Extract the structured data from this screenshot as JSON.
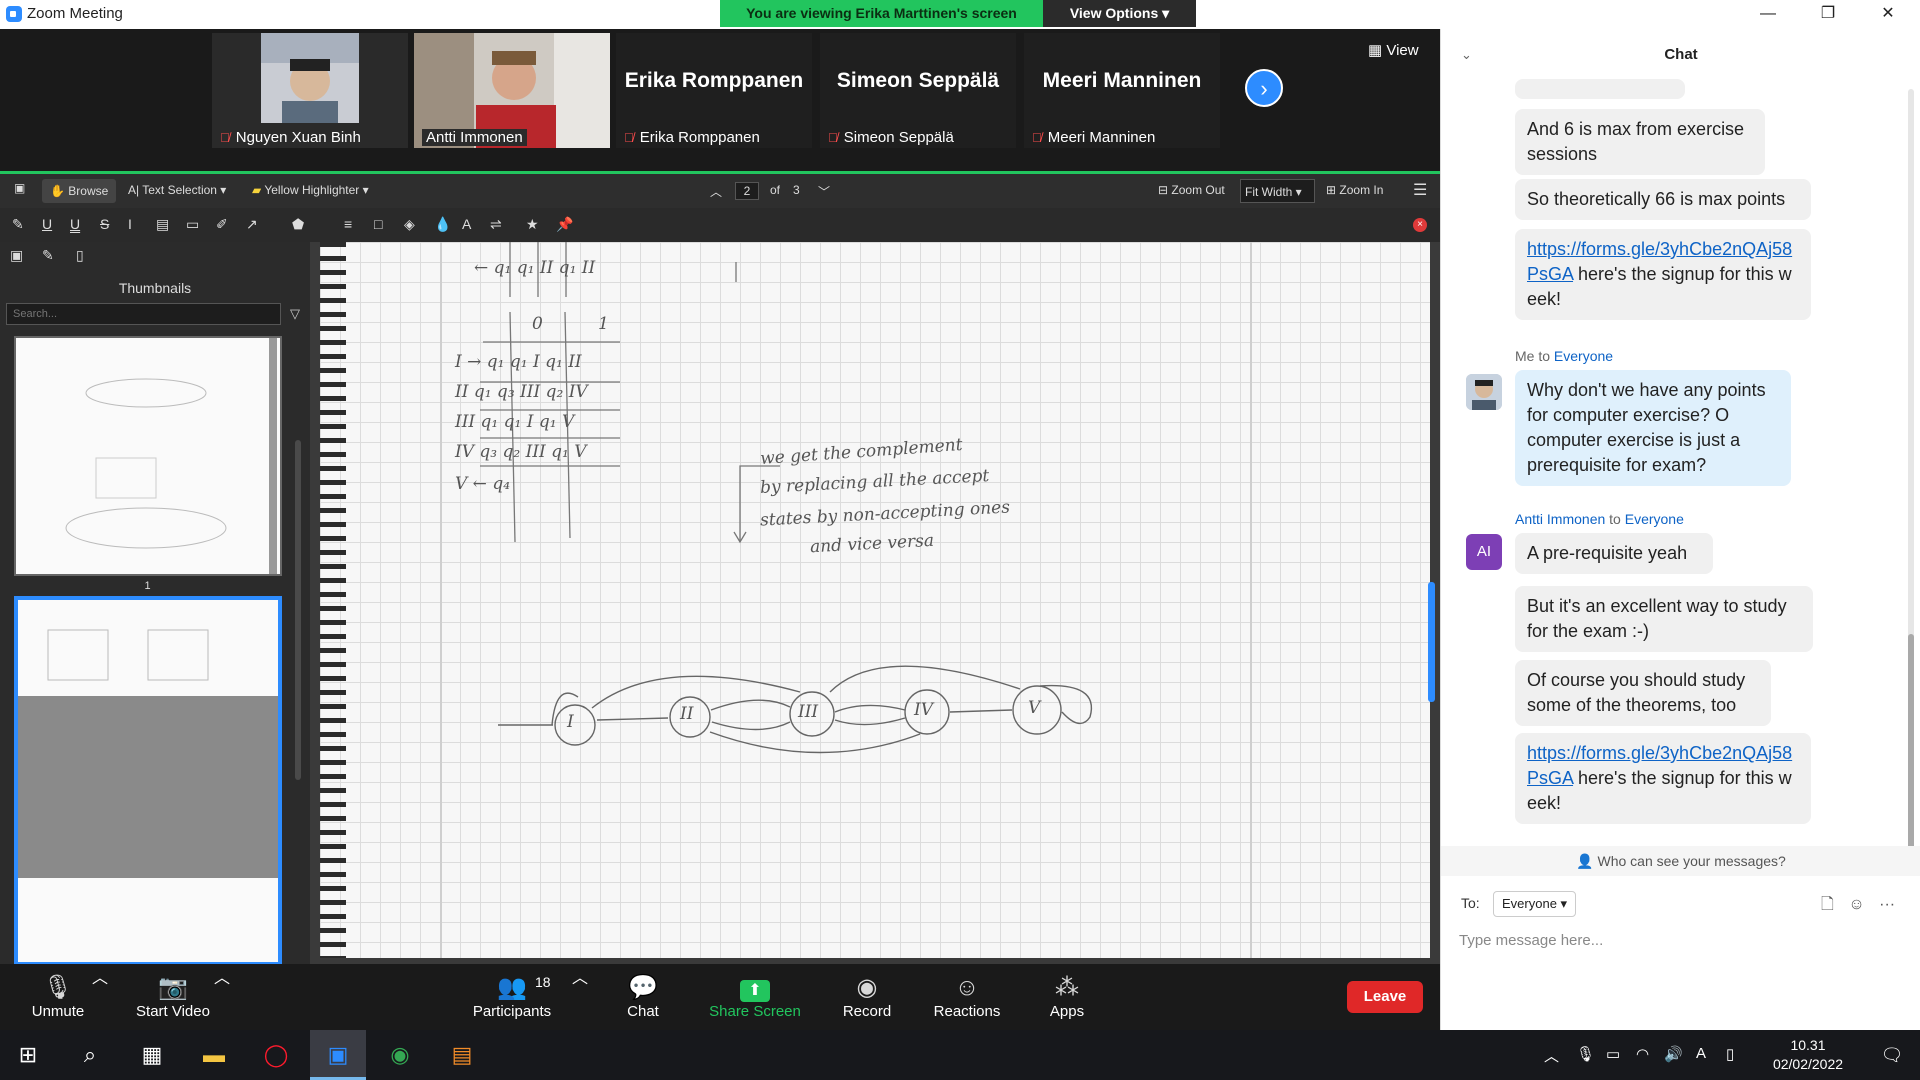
{
  "window": {
    "title": "Zoom Meeting",
    "banner": "You are viewing Erika Marttinen's screen",
    "view_options": "View Options ▾",
    "minimize": "—",
    "restore": "❐",
    "close": "✕"
  },
  "participants": [
    {
      "name": "Nguyen Xuan Binh",
      "big_name": "",
      "video": true
    },
    {
      "name": "Antti Immonen",
      "big_name": "",
      "video": true
    },
    {
      "name": "Erika Romppanen",
      "big_name": "Erika Romppanen",
      "video": false
    },
    {
      "name": "Simeon Seppälä",
      "big_name": "Simeon Seppälä",
      "video": false
    },
    {
      "name": "Meeri Manninen",
      "big_name": "Meeri Manninen",
      "video": false
    }
  ],
  "strip": {
    "view_label": "View",
    "next_icon": "›"
  },
  "viewer": {
    "toolbar": {
      "browse": "Browse",
      "text_selection": "Text Selection",
      "highlighter": "Yellow Highlighter",
      "page_current": "2",
      "page_of": "of",
      "page_total": "3",
      "zoom_out": "Zoom Out",
      "fit": "Fit Width",
      "zoom_in": "Zoom In"
    },
    "sidebar": {
      "heading": "Thumbnails",
      "search_placeholder": "Search...",
      "thumb_label": "1"
    },
    "notes": {
      "col_0": "0",
      "col_1": "1",
      "rows": [
        "I  →  q₁  q₁ I   q₁ II",
        "II      q₁  q₃ III  q₂ IV",
        "III     q₁  q₁ I   q₁ V",
        "IV     q₃  q₂ III  q₁ V",
        "V  ←  q₄"
      ],
      "comment": [
        "we get the complement",
        "by replacing all the accept",
        "states by non-accepting ones",
        "and vice versa"
      ],
      "states": [
        "I",
        "II",
        "III",
        "IV",
        "V"
      ]
    }
  },
  "controls": {
    "unmute": "Unmute",
    "start_video": "Start Video",
    "participants": "Participants",
    "participant_count": "18",
    "chat": "Chat",
    "share": "Share Screen",
    "record": "Record",
    "reactions": "Reactions",
    "apps": "Apps",
    "leave": "Leave"
  },
  "chat": {
    "title": "Chat",
    "messages": {
      "m1": "And 6 is max from exercise sessions",
      "m2": "So theoretically 66 is max points",
      "m3_link": "https://forms.gle/3yhCbe2nQAj58PsGA",
      "m3_rest": " here's the signup for this week!",
      "me_header_from": "Me to ",
      "me_header_to": "Everyone",
      "me_msg": "Why don't we have any points for computer exercise? O computer exercise is just a prerequisite for exam?",
      "antti_from": "Antti Immonen",
      "antti_mid": " to ",
      "antti_to": "Everyone",
      "antti_avatar": "AI",
      "a1": "A pre-requisite yeah",
      "a2": "But it's an excellent way to study for the exam :-)",
      "a3": "Of course you should study some of the theorems, too",
      "a4_link": "https://forms.gle/3yhCbe2nQAj58PsGA",
      "a4_rest": " here's the signup for this week!"
    },
    "who_can_see": "Who can see your messages?",
    "to_label": "To:",
    "to_value": "Everyone",
    "input_placeholder": "Type message here..."
  },
  "taskbar": {
    "time": "10.31",
    "date": "02/02/2022"
  },
  "colors": {
    "accent": "#2d8cff",
    "share_green": "#22c55e",
    "leave_red": "#e02828",
    "link": "#0e63c6"
  }
}
